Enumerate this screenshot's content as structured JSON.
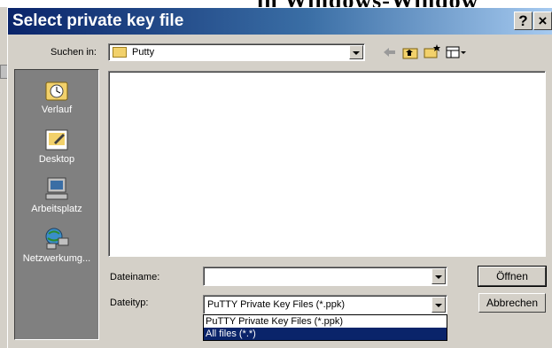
{
  "background": {
    "title_fragment": "in Windows-Window"
  },
  "dialog": {
    "title": "Select private key file",
    "help_label": "?",
    "close_label": "×",
    "look_in": {
      "label": "Suchen in:",
      "value": "Putty"
    },
    "toolbar": {
      "back_icon": "back-arrow-icon",
      "up_icon": "up-folder-icon",
      "new_folder_icon": "new-folder-icon",
      "view_menu_icon": "view-menu-icon"
    },
    "places": [
      {
        "label": "Verlauf",
        "icon": "history-icon"
      },
      {
        "label": "Desktop",
        "icon": "desktop-icon"
      },
      {
        "label": "Arbeitsplatz",
        "icon": "my-computer-icon"
      },
      {
        "label": "Netzwerkumg...",
        "icon": "network-icon"
      }
    ],
    "filename": {
      "label": "Dateiname:",
      "value": ""
    },
    "filetype": {
      "label": "Dateityp:",
      "value": "PuTTY Private Key Files (*.ppk)",
      "options": [
        "PuTTY Private Key Files (*.ppk)",
        "All files (*.*)"
      ],
      "highlighted_option": "All files (*.*)"
    },
    "buttons": {
      "open": "Öffnen",
      "cancel": "Abbrechen"
    }
  }
}
